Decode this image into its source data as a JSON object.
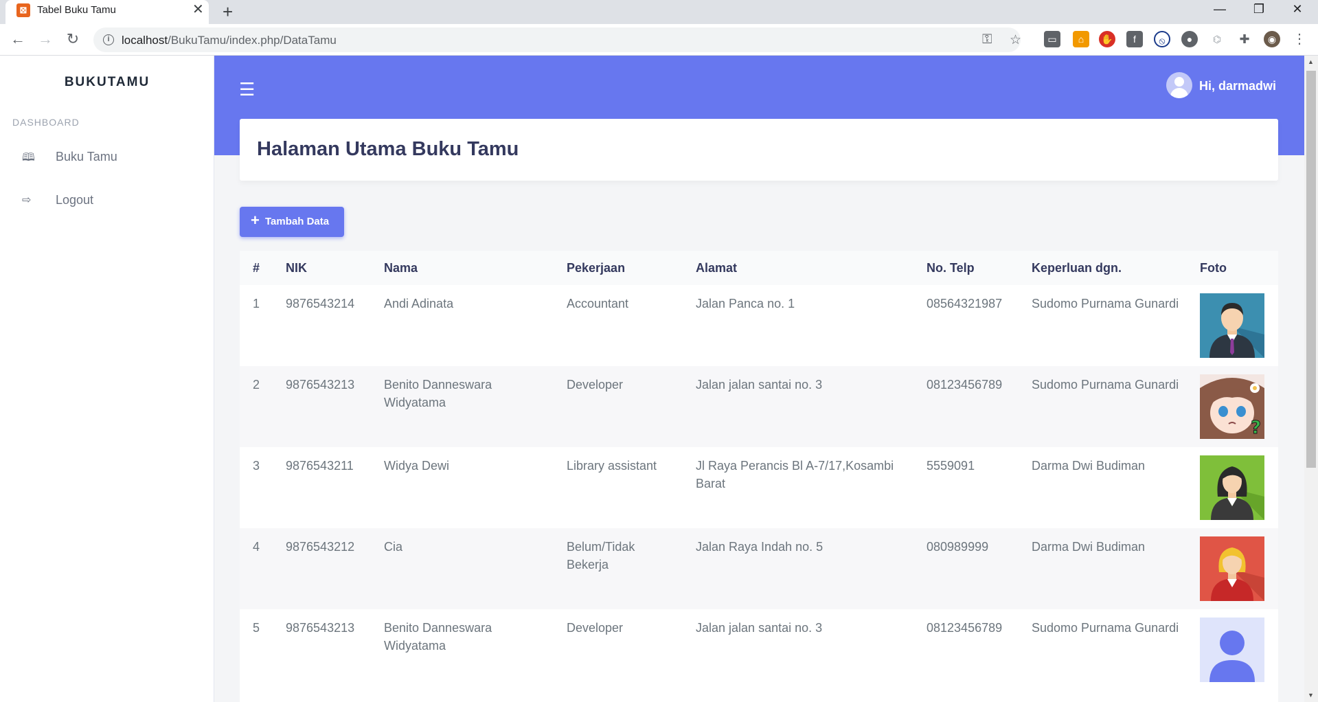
{
  "browser": {
    "tab_title": "Tabel Buku Tamu",
    "url_host": "localhost",
    "url_path": "/BukuTamu/index.php/DataTamu"
  },
  "sidebar": {
    "brand": "BUKUTAMU",
    "heading": "DASHBOARD",
    "items": [
      {
        "label": "Buku Tamu",
        "icon": "book-icon"
      },
      {
        "label": "Logout",
        "icon": "sign-out-icon"
      }
    ]
  },
  "header": {
    "greeting": "Hi, darmadwi"
  },
  "page": {
    "title": "Halaman Utama Buku Tamu",
    "add_button": "Tambah Data"
  },
  "table": {
    "columns": [
      "#",
      "NIK",
      "Nama",
      "Pekerjaan",
      "Alamat",
      "No. Telp",
      "Keperluan dgn.",
      "Foto"
    ],
    "rows": [
      {
        "no": "1",
        "nik": "9876543214",
        "nama": "Andi Adinata",
        "pekerjaan": "Accountant",
        "alamat": "Jalan Panca no. 1",
        "telp": "08564321987",
        "keperluan": "Sudomo Purnama Gunardi",
        "foto": "man-suit-avatar"
      },
      {
        "no": "2",
        "nik": "9876543213",
        "nama": "Benito Danneswara Widyatama",
        "pekerjaan": "Developer",
        "alamat": "Jalan jalan santai no. 3",
        "telp": "08123456789",
        "keperluan": "Sudomo Purnama Gunardi",
        "foto": "anime-girl-avatar"
      },
      {
        "no": "3",
        "nik": "9876543211",
        "nama": "Widya Dewi",
        "pekerjaan": "Library assistant",
        "alamat": "Jl Raya Perancis Bl A-7/17,Kosambi Barat",
        "telp": "5559091",
        "keperluan": "Darma Dwi Budiman",
        "foto": "woman-green-avatar"
      },
      {
        "no": "4",
        "nik": "9876543212",
        "nama": "Cia",
        "pekerjaan": "Belum/Tidak Bekerja",
        "alamat": "Jalan Raya Indah no. 5",
        "telp": "080989999",
        "keperluan": "Darma Dwi Budiman",
        "foto": "woman-red-avatar"
      },
      {
        "no": "5",
        "nik": "9876543213",
        "nama": "Benito Danneswara Widyatama",
        "pekerjaan": "Developer",
        "alamat": "Jalan jalan santai no. 3",
        "telp": "08123456789",
        "keperluan": "Sudomo Purnama Gunardi",
        "foto": "default-user-avatar"
      }
    ]
  },
  "colors": {
    "primary": "#6777ef",
    "title": "#34395e",
    "text": "#6c757d"
  }
}
